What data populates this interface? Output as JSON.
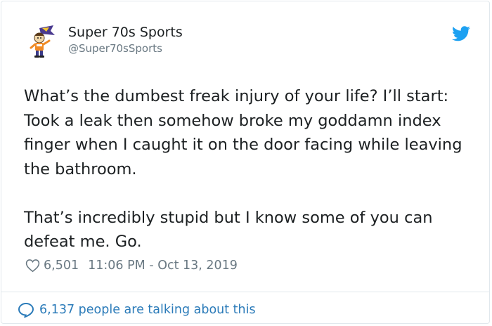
{
  "author": {
    "name": "Super 70s Sports",
    "handle": "@Super70sSports",
    "avatar_icon": "retro-mascot-avatar"
  },
  "tweet": {
    "paragraphs": [
      "What’s the dumbest freak injury of your life? I’ll start: Took a leak then somehow broke my goddamn index finger when I caught it on the door facing while leaving the bathroom.",
      "That’s incredibly stupid but I know some of you can defeat me. Go."
    ]
  },
  "meta": {
    "likes": "6,501",
    "timestamp": "11:06 PM - Oct 13, 2019",
    "like_icon": "heart-icon"
  },
  "footer": {
    "talking_text": "6,137 people are talking about this",
    "icon": "speech-bubble-icon"
  },
  "colors": {
    "twitter_blue": "#1da1f2",
    "link_blue": "#2b7bb9",
    "secondary_text": "#697882",
    "primary_text": "#1c2022",
    "border": "#e1e8ed"
  }
}
